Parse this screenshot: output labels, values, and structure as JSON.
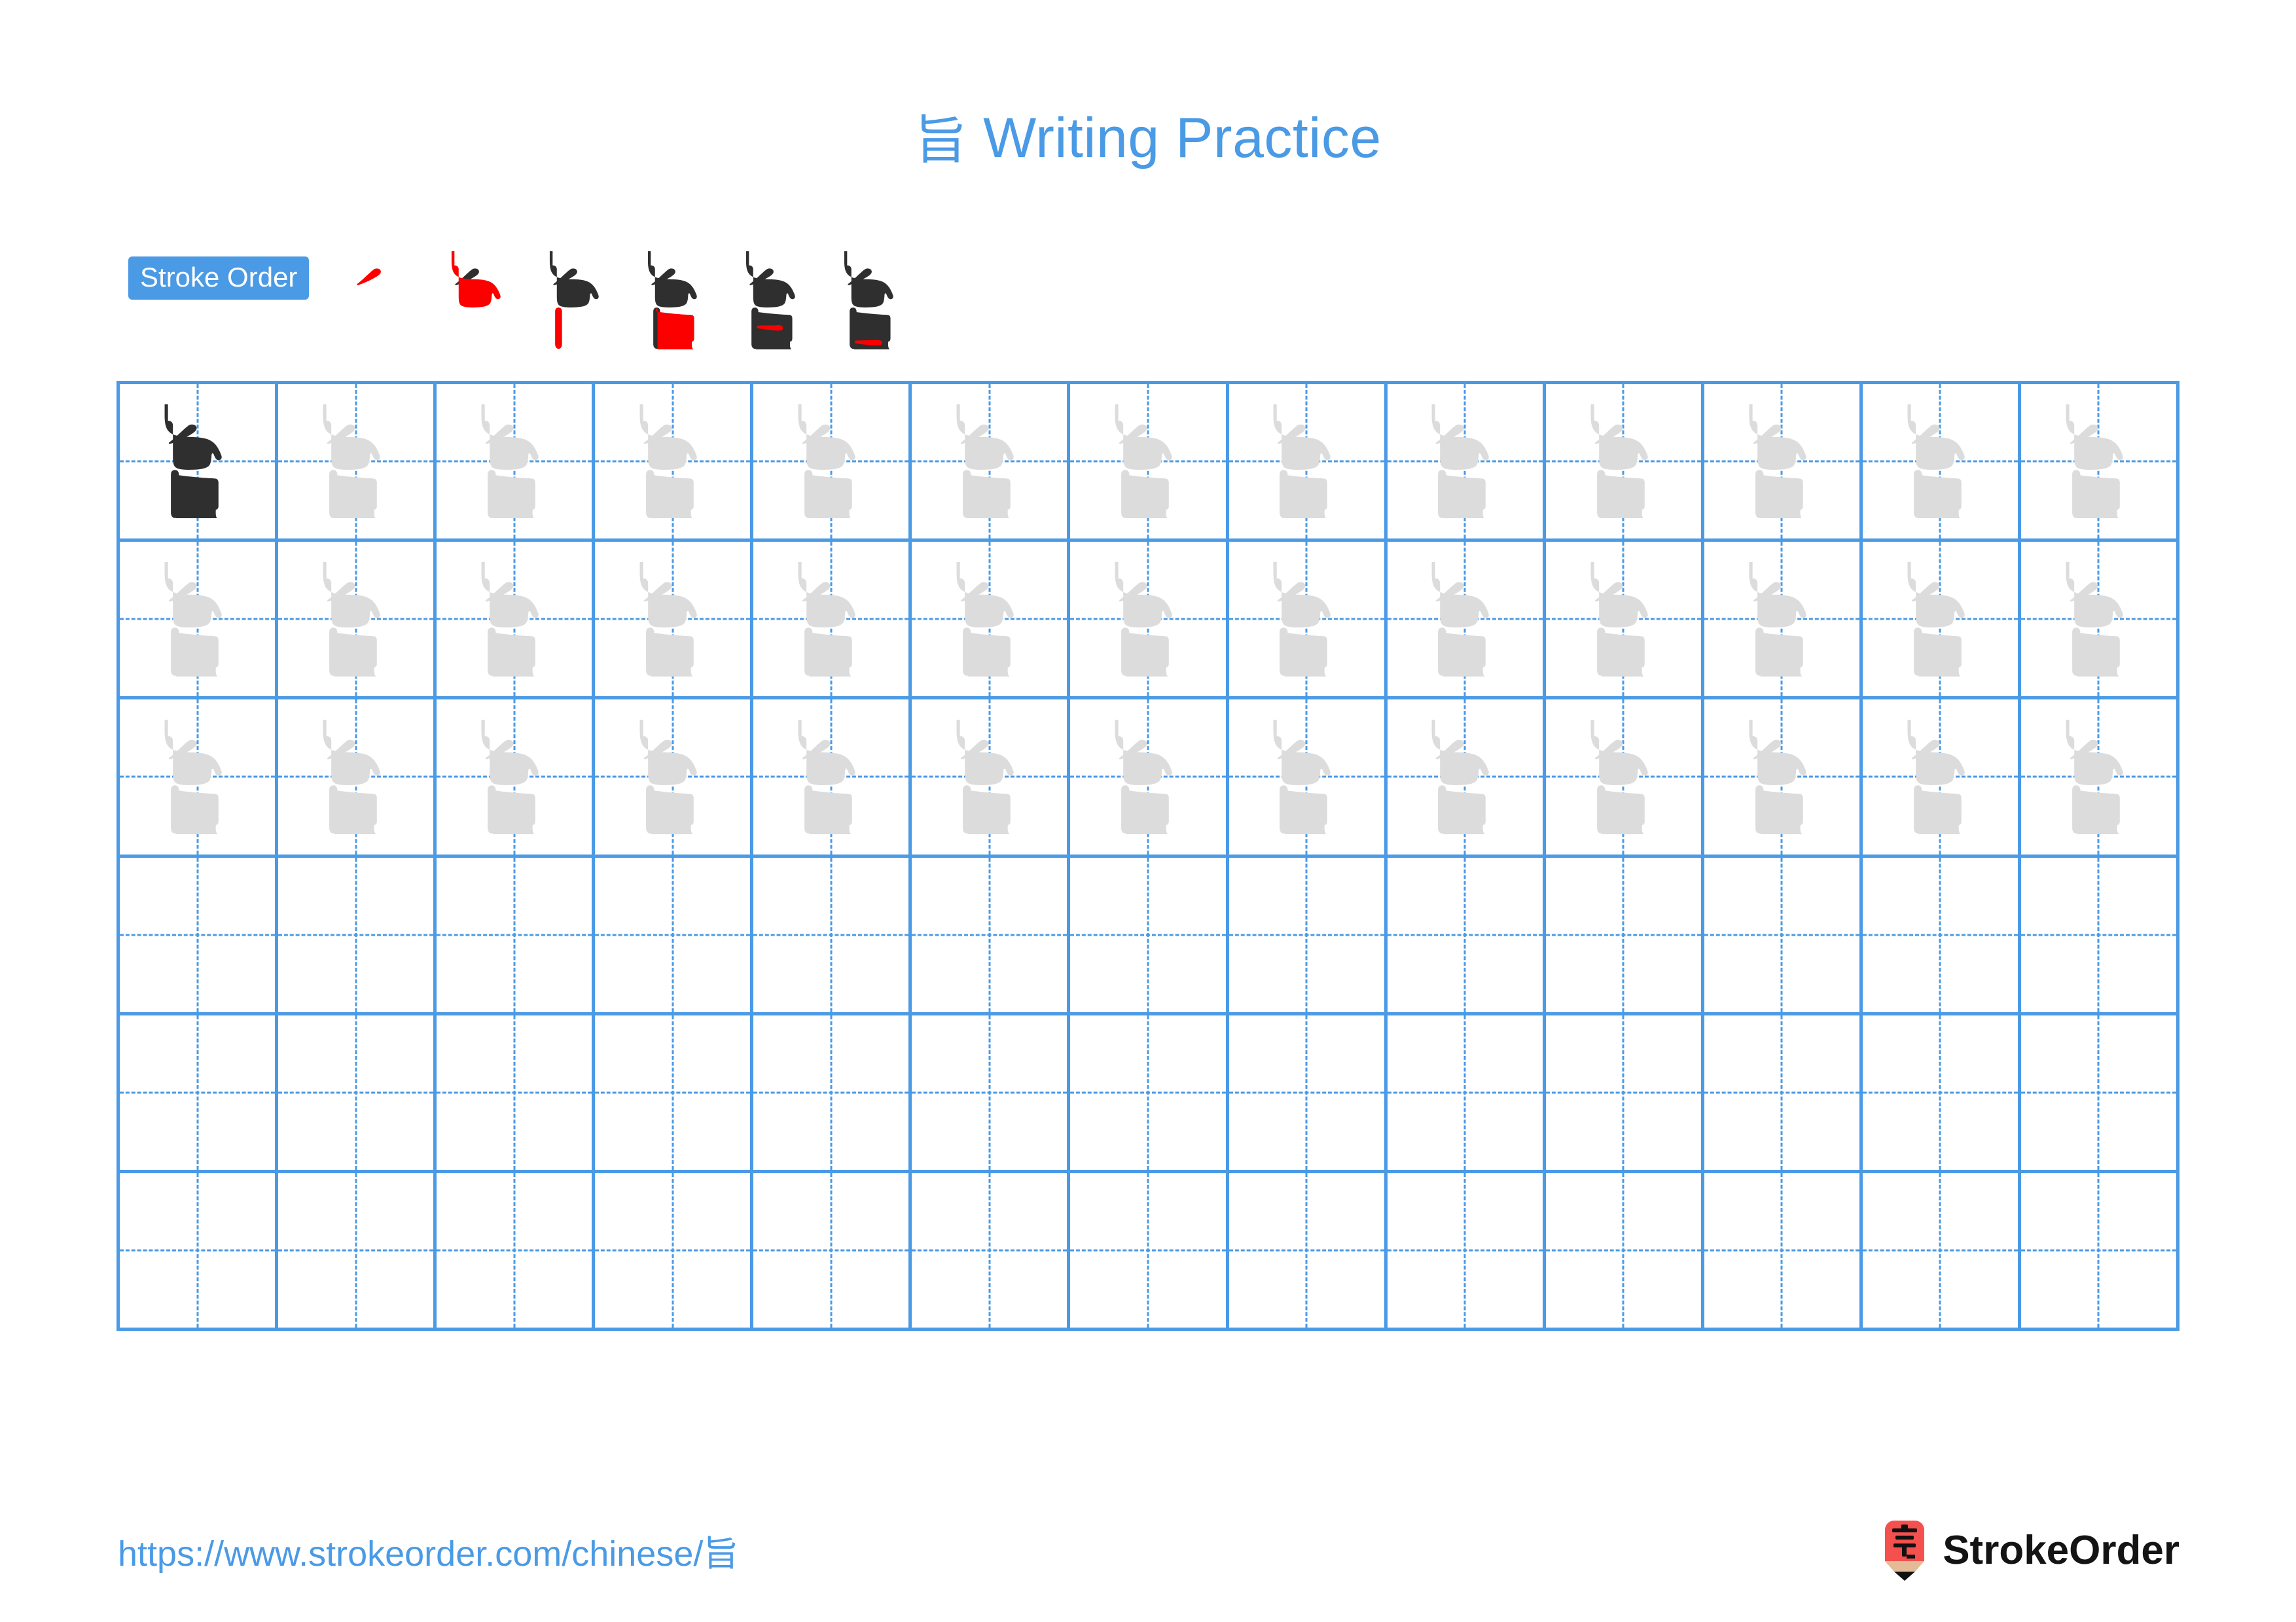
{
  "page": {
    "character": "旨",
    "title_text": "旨 Writing Practice",
    "title_suffix": "Writing Practice",
    "background_color": "#ffffff",
    "accent_color": "#4a9ae5",
    "stroke_highlight_color": "#fc0000",
    "guide_char_color": "#dcdcdc",
    "model_char_color": "#2f2f2f"
  },
  "stroke_order": {
    "badge_label": "Stroke Order",
    "badge_background": "#4a9ae5",
    "badge_text_color": "#ffffff",
    "stroke_count": 6,
    "steps": [
      {
        "index": 1,
        "strokes_shown": 1,
        "new_stroke_name": "pie"
      },
      {
        "index": 2,
        "strokes_shown": 2,
        "new_stroke_name": "shu-wan-gou"
      },
      {
        "index": 3,
        "strokes_shown": 3,
        "new_stroke_name": "shu"
      },
      {
        "index": 4,
        "strokes_shown": 4,
        "new_stroke_name": "heng-zhe-gou"
      },
      {
        "index": 5,
        "strokes_shown": 5,
        "new_stroke_name": "heng"
      },
      {
        "index": 6,
        "strokes_shown": 6,
        "new_stroke_name": "heng"
      }
    ]
  },
  "practice_grid": {
    "columns": 13,
    "rows": 6,
    "grid_line_color": "#4a9ae5",
    "cells": [
      [
        "model",
        "trace",
        "trace",
        "trace",
        "trace",
        "trace",
        "trace",
        "trace",
        "trace",
        "trace",
        "trace",
        "trace",
        "trace"
      ],
      [
        "trace",
        "trace",
        "trace",
        "trace",
        "trace",
        "trace",
        "trace",
        "trace",
        "trace",
        "trace",
        "trace",
        "trace",
        "trace"
      ],
      [
        "trace",
        "trace",
        "trace",
        "trace",
        "trace",
        "trace",
        "trace",
        "trace",
        "trace",
        "trace",
        "trace",
        "trace",
        "trace"
      ],
      [
        "empty",
        "empty",
        "empty",
        "empty",
        "empty",
        "empty",
        "empty",
        "empty",
        "empty",
        "empty",
        "empty",
        "empty",
        "empty"
      ],
      [
        "empty",
        "empty",
        "empty",
        "empty",
        "empty",
        "empty",
        "empty",
        "empty",
        "empty",
        "empty",
        "empty",
        "empty",
        "empty"
      ],
      [
        "empty",
        "empty",
        "empty",
        "empty",
        "empty",
        "empty",
        "empty",
        "empty",
        "empty",
        "empty",
        "empty",
        "empty",
        "empty"
      ]
    ]
  },
  "footer": {
    "url": "https://www.strokeorder.com/chinese/旨",
    "brand_name": "StrokeOrder",
    "logo_character": "字",
    "logo_background": "#f4514e",
    "logo_tip_color": "#e3bb96"
  }
}
